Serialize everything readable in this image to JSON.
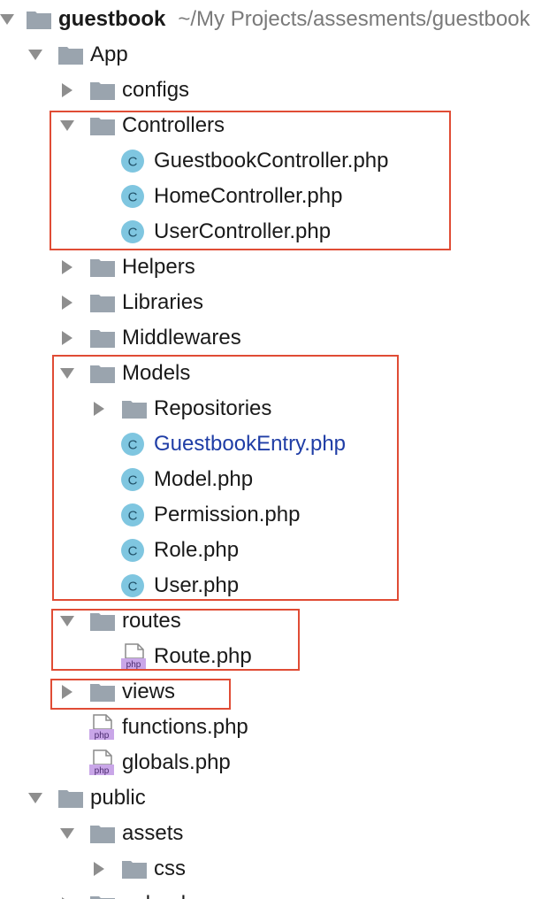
{
  "project": {
    "name": "guestbook",
    "path": "~/My Projects/assesments/guestbook"
  },
  "tree": [
    {
      "label": "App",
      "kind": "folder",
      "state": "expanded"
    },
    {
      "label": "configs",
      "kind": "folder",
      "state": "collapsed"
    },
    {
      "label": "Controllers",
      "kind": "folder",
      "state": "expanded"
    },
    {
      "label": "GuestbookController.php",
      "kind": "class-file"
    },
    {
      "label": "HomeController.php",
      "kind": "class-file"
    },
    {
      "label": "UserController.php",
      "kind": "class-file"
    },
    {
      "label": "Helpers",
      "kind": "folder",
      "state": "collapsed"
    },
    {
      "label": "Libraries",
      "kind": "folder",
      "state": "collapsed"
    },
    {
      "label": "Middlewares",
      "kind": "folder",
      "state": "collapsed"
    },
    {
      "label": "Models",
      "kind": "folder",
      "state": "expanded"
    },
    {
      "label": "Repositories",
      "kind": "folder",
      "state": "collapsed"
    },
    {
      "label": "GuestbookEntry.php",
      "kind": "class-file",
      "status": "modified"
    },
    {
      "label": "Model.php",
      "kind": "class-file"
    },
    {
      "label": "Permission.php",
      "kind": "class-file"
    },
    {
      "label": "Role.php",
      "kind": "class-file"
    },
    {
      "label": "User.php",
      "kind": "class-file"
    },
    {
      "label": "routes",
      "kind": "folder",
      "state": "expanded"
    },
    {
      "label": "Route.php",
      "kind": "php-file"
    },
    {
      "label": "views",
      "kind": "folder",
      "state": "collapsed"
    },
    {
      "label": "functions.php",
      "kind": "php-file"
    },
    {
      "label": "globals.php",
      "kind": "php-file"
    },
    {
      "label": "public",
      "kind": "folder",
      "state": "expanded"
    },
    {
      "label": "assets",
      "kind": "folder",
      "state": "expanded"
    },
    {
      "label": "css",
      "kind": "folder",
      "state": "collapsed"
    },
    {
      "label": "uploads",
      "kind": "folder",
      "state": "collapsed"
    }
  ],
  "icons": {
    "class_badge": "C",
    "php_badge": "php"
  },
  "colors": {
    "highlight": "#e04c35",
    "folder": "#9aa4ae",
    "class_icon": "#7fc6e0",
    "php_badge": "#c9a6e8",
    "modified_text": "#1f3da6",
    "arrow": "#8e8e8e"
  }
}
